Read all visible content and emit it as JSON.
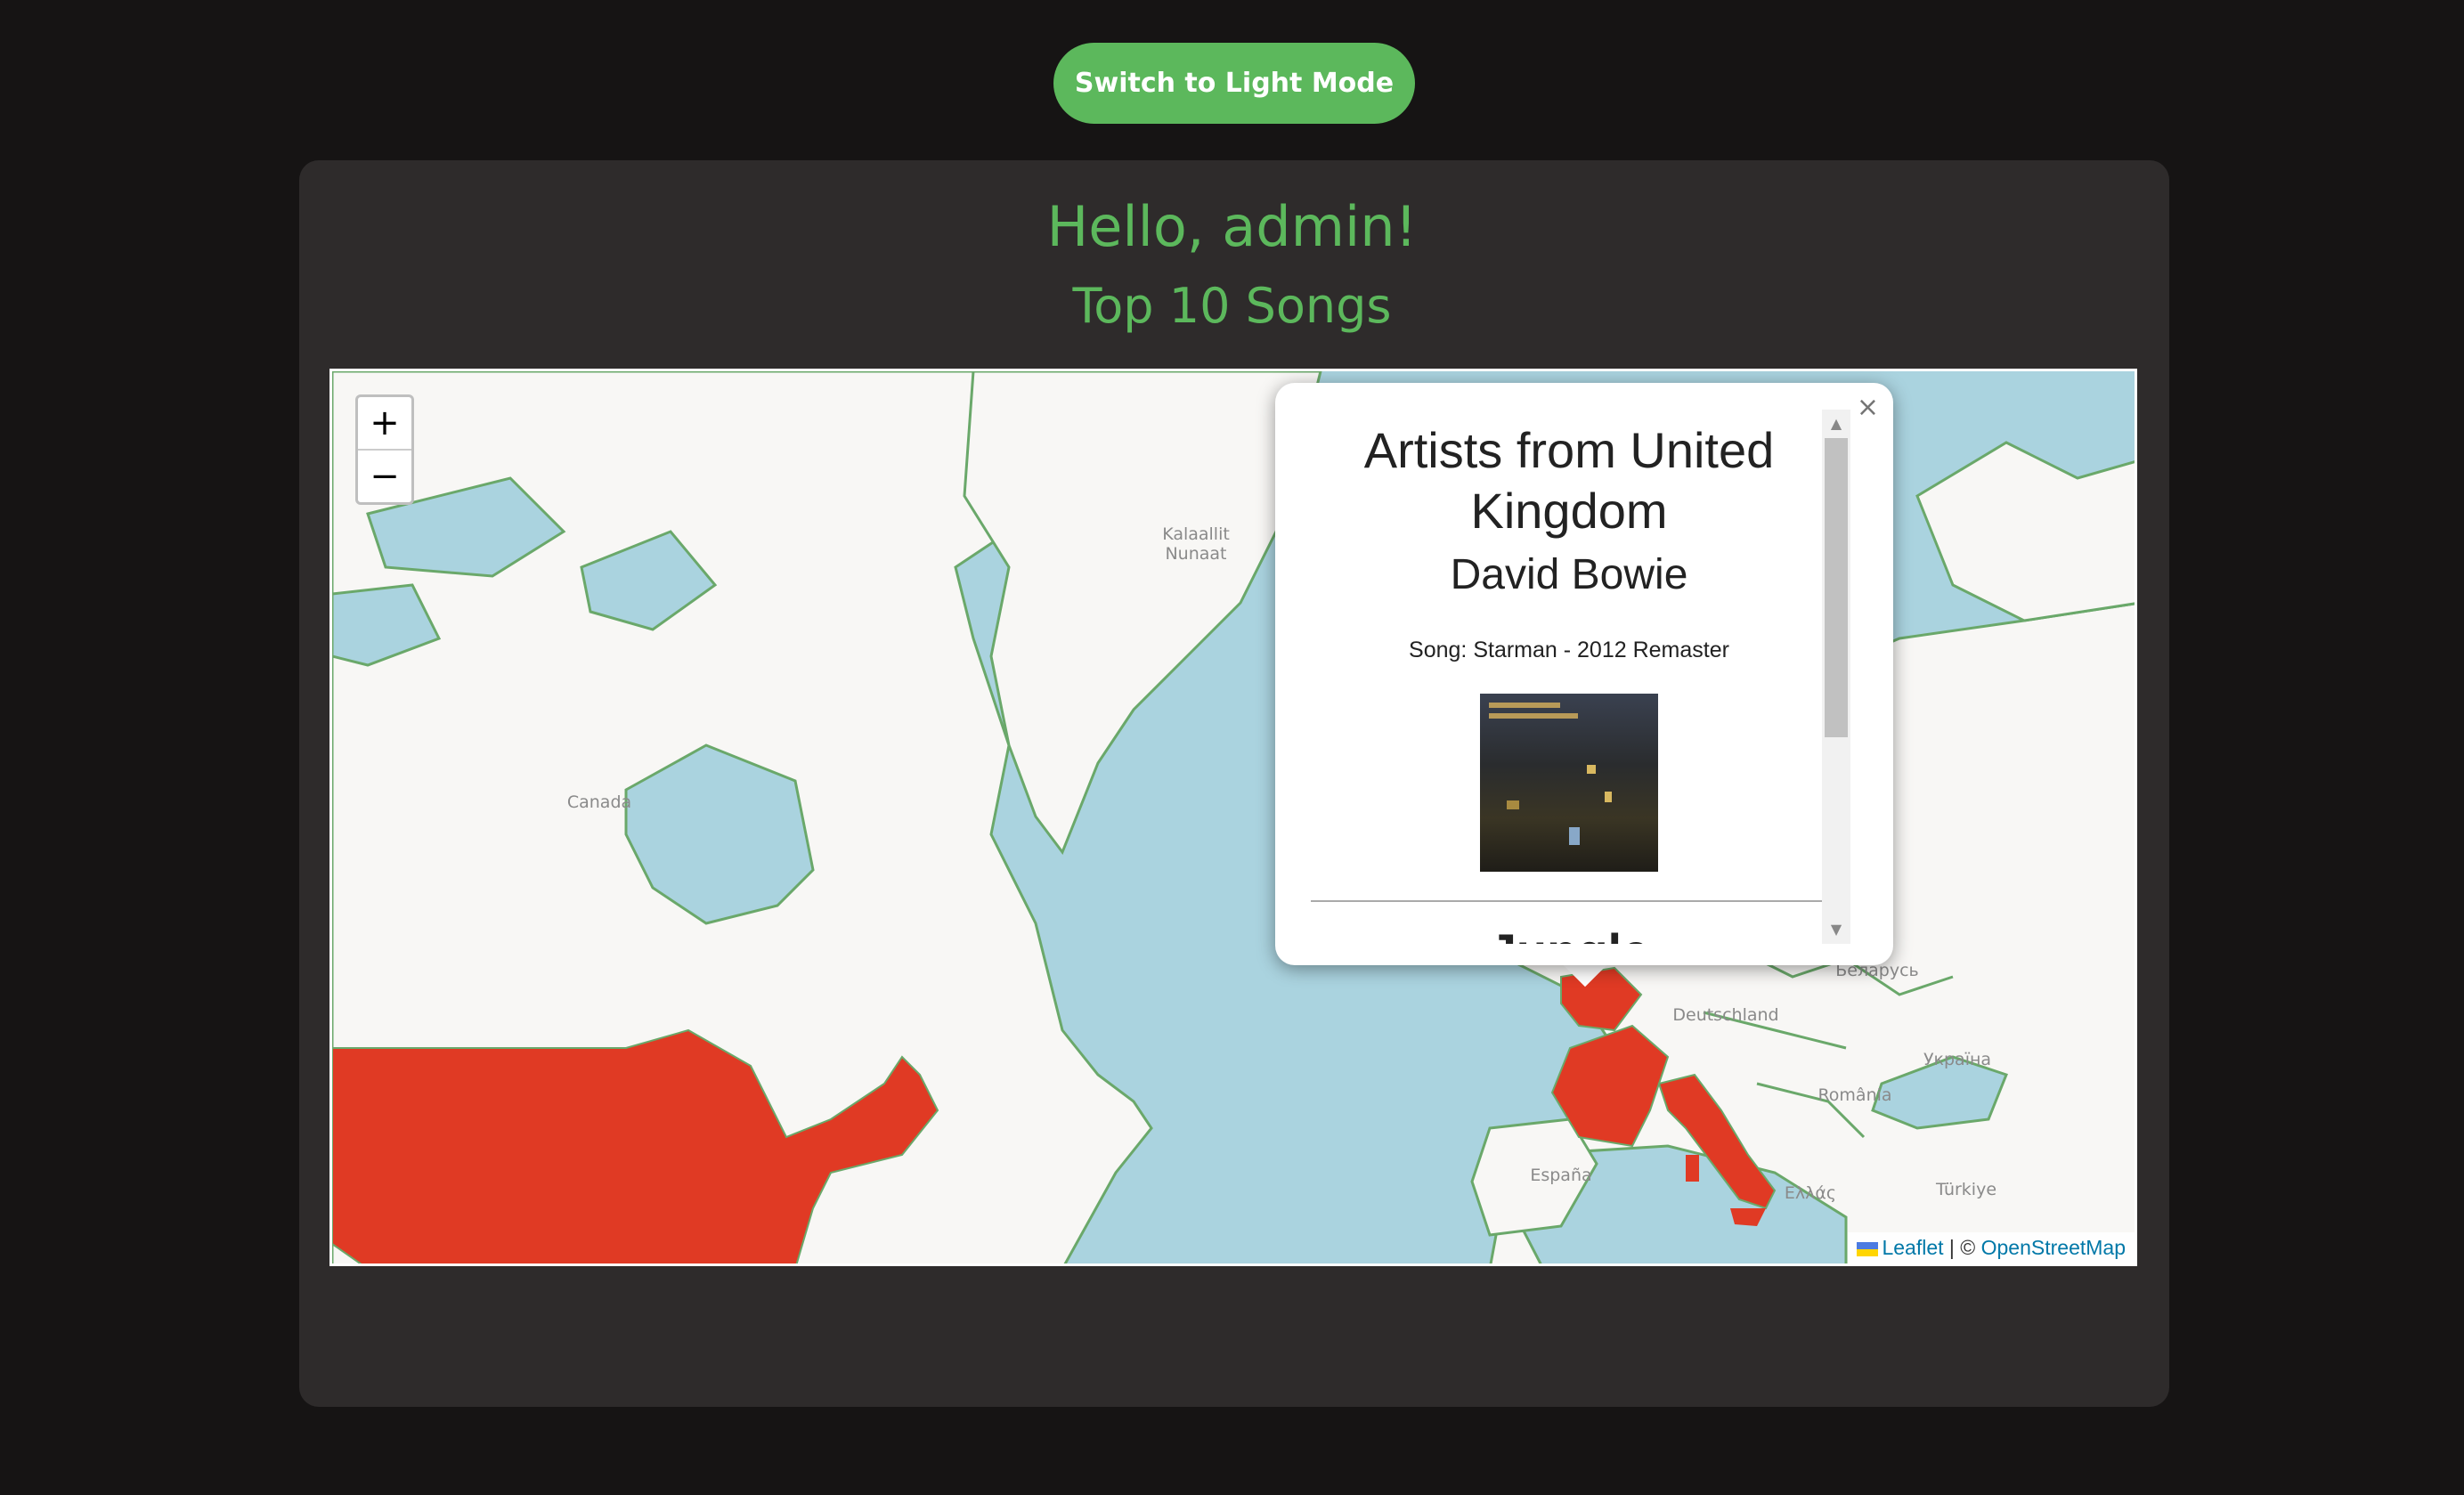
{
  "theme_button": {
    "label": "Switch to Light Mode"
  },
  "header": {
    "greeting": "Hello, admin!",
    "subtitle": "Top 10 Songs"
  },
  "map": {
    "zoom_in": "+",
    "zoom_out": "−",
    "labels": {
      "greenland": "Kalaallit\nNunaat",
      "canada": "Canada",
      "germany": "Deutschland",
      "belarus": "Беларусь",
      "ukraine": "Україна",
      "romania": "România",
      "spain": "España",
      "turkey": "Türkiye",
      "greece": "Ελλάς"
    },
    "attribution": {
      "leaflet": "Leaflet",
      "separator": "| ©",
      "osm": "OpenStreetMap"
    },
    "colors": {
      "water": "#aad3df",
      "land": "#f8f7f5",
      "border": "#6aa86a",
      "highlight": "#e03a24"
    }
  },
  "popup": {
    "title": "Artists from United Kingdom",
    "artist": "David Bowie",
    "song": "Song: Starman - 2012 Remaster",
    "album_alt": "David Bowie Ziggy Stardust album cover",
    "next_artist": "Jungle",
    "close": "×"
  },
  "colors": {
    "accent": "#5cb85c",
    "background": "#161414",
    "card": "#2e2b2b"
  }
}
